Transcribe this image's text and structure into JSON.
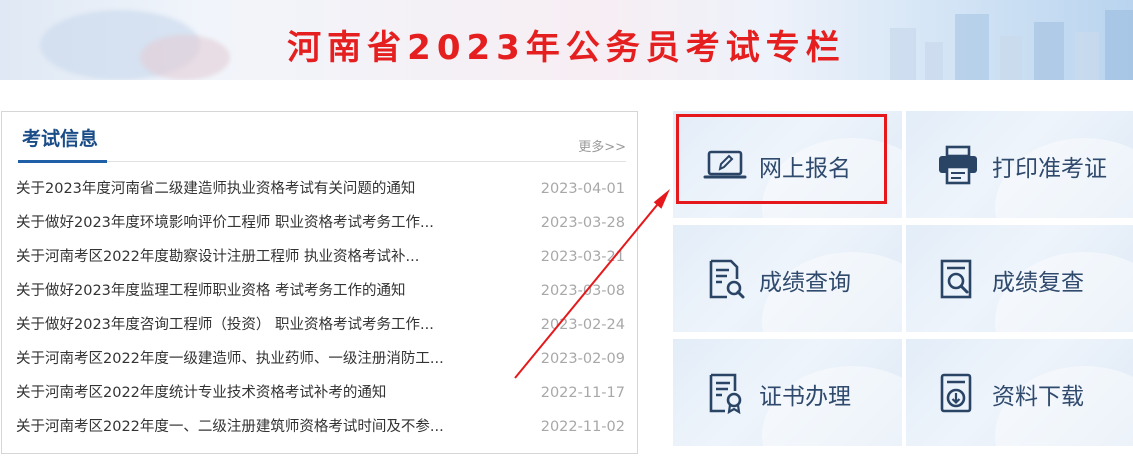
{
  "banner": {
    "title": "河南省2023年公务员考试专栏"
  },
  "news": {
    "title": "考试信息",
    "more": "更多>>",
    "items": [
      {
        "text": "关于2023年度河南省二级建造师执业资格考试有关问题的通知",
        "date": "2023-04-01"
      },
      {
        "text": "关于做好2023年度环境影响评价工程师 职业资格考试考务工作...",
        "date": "2023-03-28"
      },
      {
        "text": "关于河南考区2022年度勘察设计注册工程师 执业资格考试补...",
        "date": "2023-03-21"
      },
      {
        "text": "关于做好2023年度监理工程师职业资格 考试考务工作的通知",
        "date": "2023-03-08"
      },
      {
        "text": "关于做好2023年度咨询工程师（投资） 职业资格考试考务工作...",
        "date": "2023-02-24"
      },
      {
        "text": "关于河南考区2022年度一级建造师、执业药师、一级注册消防工...",
        "date": "2023-02-09"
      },
      {
        "text": "关于河南考区2022年度统计专业技术资格考试补考的通知",
        "date": "2022-11-17"
      },
      {
        "text": "关于河南考区2022年度一、二级注册建筑师资格考试时间及不参...",
        "date": "2022-11-02"
      }
    ]
  },
  "tiles": [
    {
      "label": "网上报名",
      "icon": "laptop-edit-icon"
    },
    {
      "label": "打印准考证",
      "icon": "printer-icon"
    },
    {
      "label": "成绩查询",
      "icon": "document-search-icon"
    },
    {
      "label": "成绩复查",
      "icon": "magnify-document-icon"
    },
    {
      "label": "证书办理",
      "icon": "certificate-icon"
    },
    {
      "label": "资料下载",
      "icon": "download-document-icon"
    }
  ],
  "colors": {
    "banner_title": "#e51f1f",
    "news_title": "#1a4d88",
    "tile_label": "#2f4a6d",
    "icon": "#2a4466",
    "highlight": "#e5191b"
  }
}
